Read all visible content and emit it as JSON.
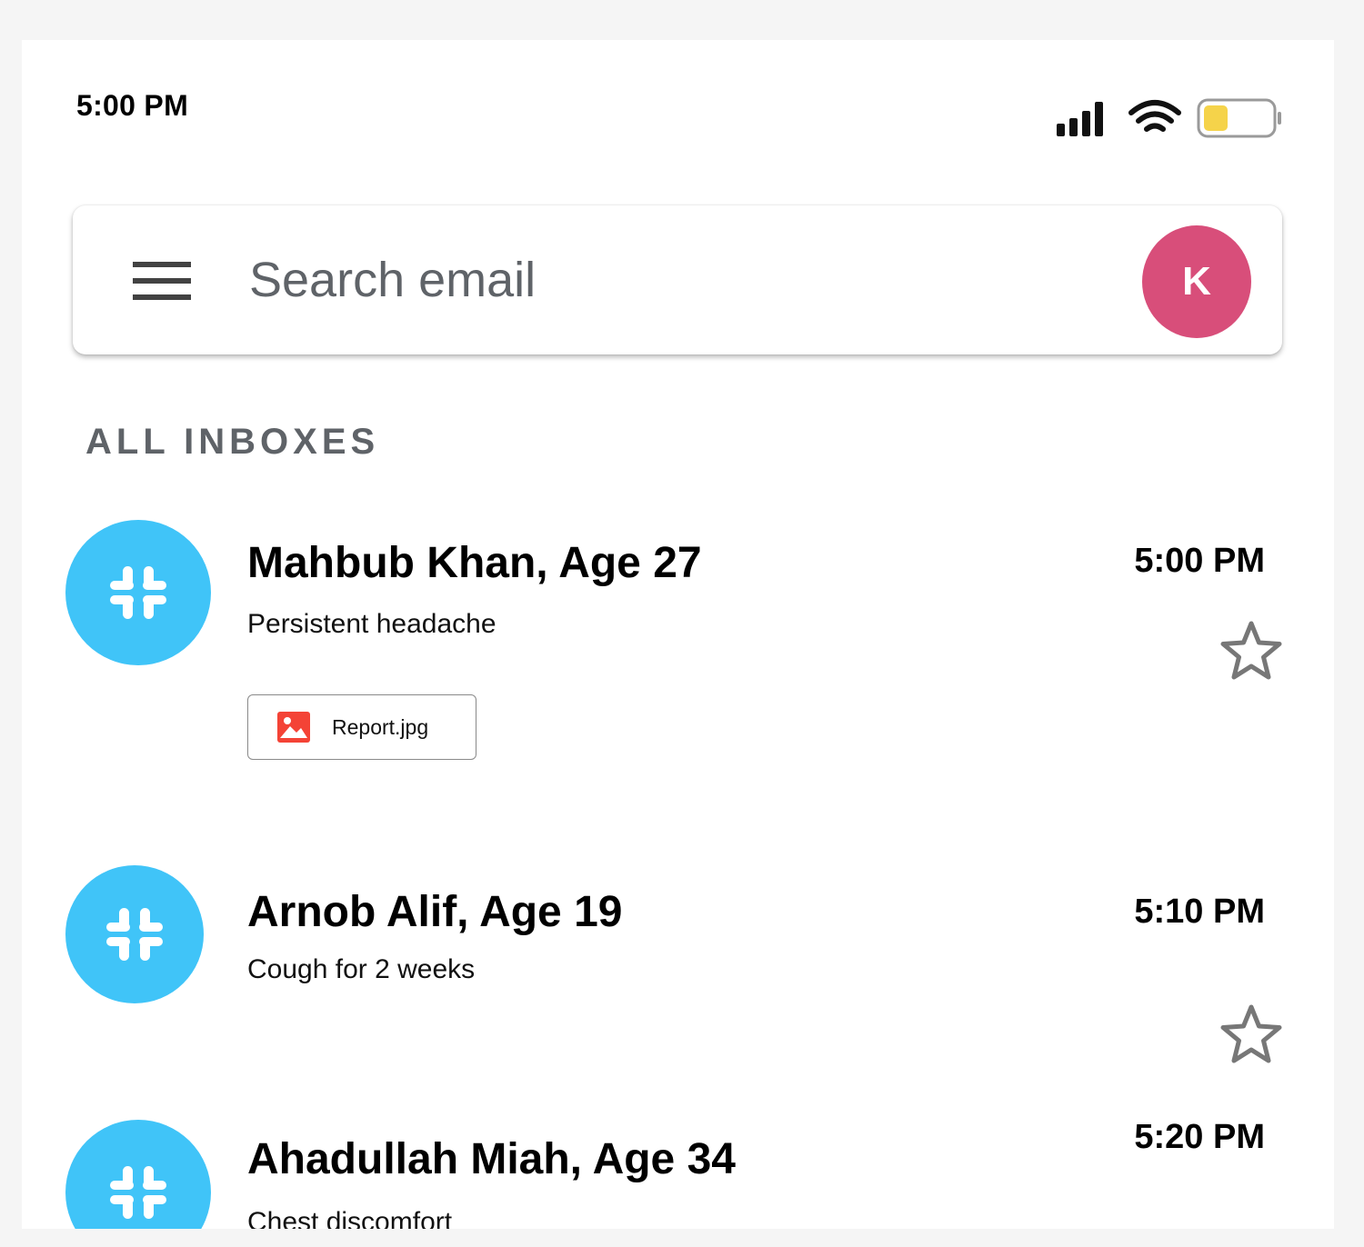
{
  "status_bar": {
    "time": "5:00 PM",
    "icons": [
      "signal-icon",
      "wifi-icon",
      "battery-icon"
    ],
    "battery_fill_color": "#f5d34a"
  },
  "search": {
    "placeholder": "Search email",
    "avatar_letter": "K",
    "avatar_color": "#d84e7a"
  },
  "section": {
    "label": "ALL INBOXES"
  },
  "emails": [
    {
      "sender": "Mahbub Khan, Age 27",
      "subject": "Persistent headache",
      "time": "5:00 PM",
      "starred": false,
      "attachment": {
        "name": "Report.jpg",
        "icon": "image-file-icon"
      }
    },
    {
      "sender": "Arnob Alif, Age 19",
      "subject": "Cough for 2 weeks",
      "time": "5:10 PM",
      "starred": false
    },
    {
      "sender": "Ahadullah Miah, Age 34",
      "subject": "Chest discomfort",
      "time": "5:20 PM",
      "starred": false
    }
  ],
  "colors": {
    "row_avatar": "#40c4f8",
    "attachment_icon": "#f44336"
  }
}
